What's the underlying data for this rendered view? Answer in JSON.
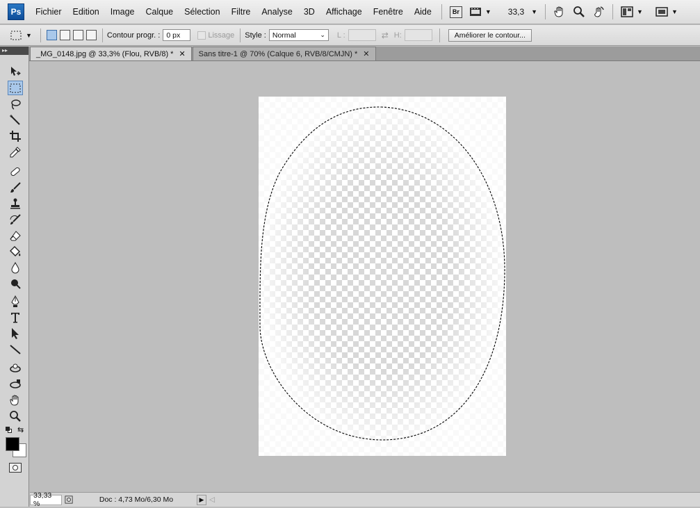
{
  "app": {
    "logo": "Ps"
  },
  "menu": [
    "Fichier",
    "Edition",
    "Image",
    "Calque",
    "Sélection",
    "Filtre",
    "Analyse",
    "3D",
    "Affichage",
    "Fenêtre",
    "Aide"
  ],
  "menubar_right": {
    "bridge_label": "Br",
    "zoom_value": "33,3"
  },
  "options": {
    "feather_label": "Contour progr. :",
    "feather_value": "0 px",
    "antialias_label": "Lissage",
    "style_label": "Style :",
    "style_value": "Normal",
    "width_label": "L :",
    "height_label": "H:",
    "refine_button": "Améliorer le contour..."
  },
  "tabs": [
    {
      "label": "_MG_0148.jpg @ 33,3% (Flou, RVB/8) *",
      "active": true
    },
    {
      "label": "Sans titre-1 @ 70% (Calque 6, RVB/8/CMJN) *",
      "active": false
    }
  ],
  "toolbar_head": "▸▸",
  "tools": [
    "move-icon",
    "rect-marquee-icon",
    "lasso-icon",
    "magic-wand-icon",
    "crop-icon",
    "eyedropper-icon",
    "healing-brush-icon",
    "brush-icon",
    "clone-stamp-icon",
    "history-brush-icon",
    "eraser-icon",
    "paint-bucket-icon",
    "blur-icon",
    "dodge-icon",
    "pen-icon",
    "type-icon",
    "path-selection-icon",
    "line-icon",
    "3d-rotate-icon",
    "3d-orbit-icon",
    "hand-icon",
    "zoom-icon"
  ],
  "status": {
    "zoom": "33,33 %",
    "doc_info": "Doc : 4,73 Mo/6,30 Mo"
  },
  "colors": {
    "foreground": "#000000",
    "background": "#ffffff",
    "accent": "#a9c8ea"
  }
}
